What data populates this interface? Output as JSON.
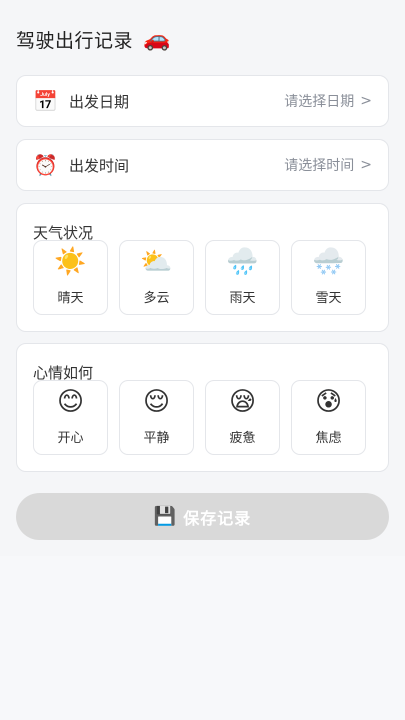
{
  "header": {
    "title": "驾驶出行记录",
    "title_icon": "🚗"
  },
  "date_row": {
    "icon": "📅",
    "label": "出发日期",
    "value": "请选择日期",
    "chevron": ">"
  },
  "time_row": {
    "icon": "⏰",
    "label": "出发时间",
    "value": "请选择时间",
    "chevron": ">"
  },
  "weather": {
    "title": "天气状况",
    "options": [
      {
        "icon": "☀️",
        "label": "晴天"
      },
      {
        "icon": "⛅",
        "label": "多云"
      },
      {
        "icon": "🌧️",
        "label": "雨天"
      },
      {
        "icon": "🌨️",
        "label": "雪天"
      }
    ]
  },
  "mood": {
    "title": "心情如何",
    "options": [
      {
        "icon": "😊",
        "label": "开心"
      },
      {
        "icon": "😌",
        "label": "平静"
      },
      {
        "icon": "😪",
        "label": "疲惫"
      },
      {
        "icon": "😰",
        "label": "焦虑"
      }
    ]
  },
  "save_button": {
    "icon": "💾",
    "label": "保存记录",
    "enabled": false
  },
  "colors": {
    "background": "#f5f6f8",
    "card": "#ffffff",
    "border": "#e4e6ea",
    "muted_text": "#8a8f99",
    "disabled_button": "#d9d9d9"
  }
}
